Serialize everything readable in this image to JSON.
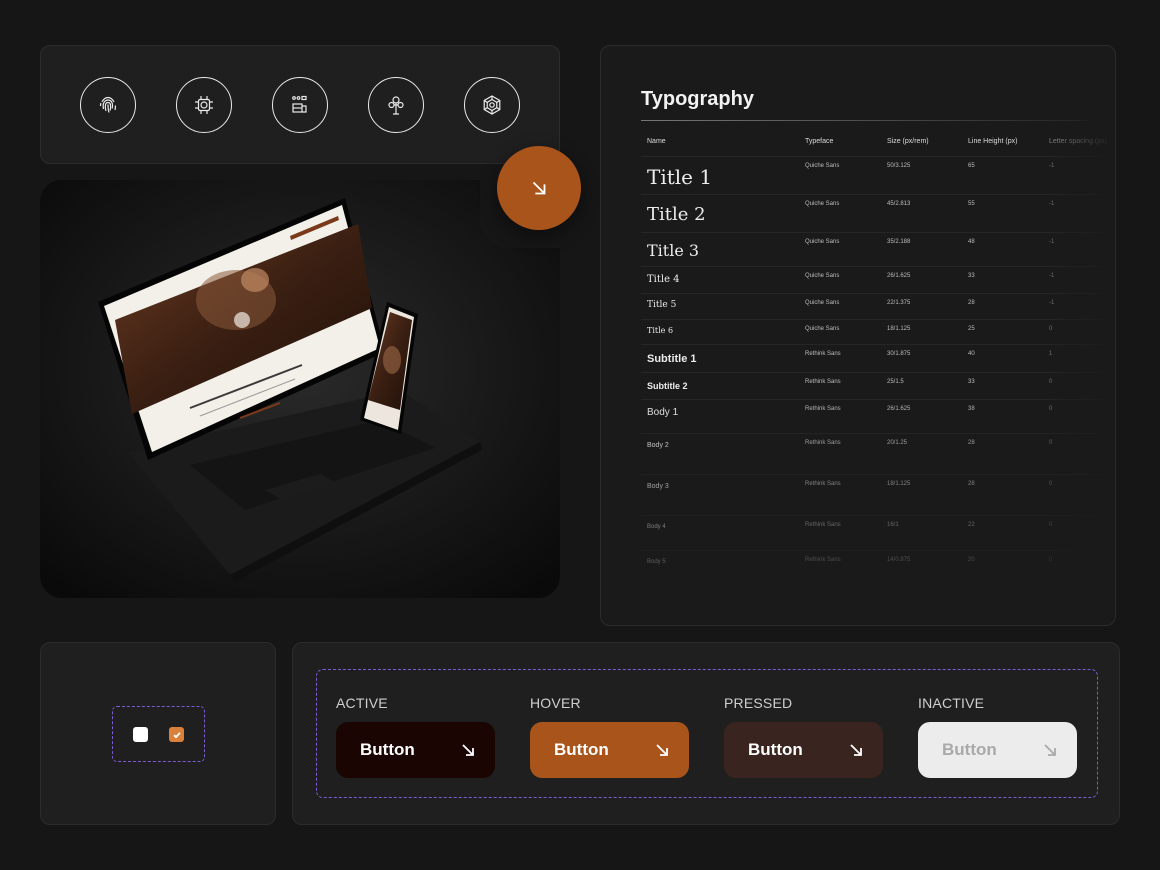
{
  "icons": [
    "fingerprint-icon",
    "chip-icon",
    "workbench-icon",
    "flower-icon",
    "hexagon-gem-icon"
  ],
  "accent_color": "#a8541a",
  "typography": {
    "title": "Typography",
    "headers": {
      "name": "Name",
      "typeface": "Typeface",
      "size": "Size (px/rem)",
      "line_height": "Line Height (px)",
      "letter_spacing": "Letter spacing (px)"
    },
    "rows": [
      {
        "name": "Title 1",
        "typeface": "Quiche Sans",
        "size": "50/3.125",
        "line_height": "65",
        "letter_spacing": "-1"
      },
      {
        "name": "Title 2",
        "typeface": "Quiche Sans",
        "size": "45/2.813",
        "line_height": "55",
        "letter_spacing": "-1"
      },
      {
        "name": "Title 3",
        "typeface": "Quiche Sans",
        "size": "35/2.188",
        "line_height": "48",
        "letter_spacing": "-1"
      },
      {
        "name": "Title 4",
        "typeface": "Quiche Sans",
        "size": "26/1.625",
        "line_height": "33",
        "letter_spacing": "-1"
      },
      {
        "name": "Title 5",
        "typeface": "Quiche Sans",
        "size": "22/1.375",
        "line_height": "28",
        "letter_spacing": "-1"
      },
      {
        "name": "Title 6",
        "typeface": "Quiche Sans",
        "size": "18/1.125",
        "line_height": "25",
        "letter_spacing": "0"
      },
      {
        "name": "Subtitle 1",
        "typeface": "Rethink Sans",
        "size": "30/1.875",
        "line_height": "40",
        "letter_spacing": "1"
      },
      {
        "name": "Subtitle 2",
        "typeface": "Rethink Sans",
        "size": "25/1.5",
        "line_height": "33",
        "letter_spacing": "0"
      },
      {
        "name": "Body 1",
        "typeface": "Rethink Sans",
        "size": "26/1.625",
        "line_height": "38",
        "letter_spacing": "0"
      },
      {
        "name": "Body 2",
        "typeface": "Rethink Sans",
        "size": "20/1.25",
        "line_height": "28",
        "letter_spacing": "0"
      },
      {
        "name": "Body 3",
        "typeface": "Rethink Sans",
        "size": "18/1.125",
        "line_height": "28",
        "letter_spacing": "0"
      },
      {
        "name": "Body 4",
        "typeface": "Rethink Sans",
        "size": "16/1",
        "line_height": "22",
        "letter_spacing": "0"
      },
      {
        "name": "Body 5",
        "typeface": "Rethink Sans",
        "size": "14/0.875",
        "line_height": "20",
        "letter_spacing": "0"
      }
    ]
  },
  "checkboxes": [
    {
      "state": "unchecked"
    },
    {
      "state": "checked"
    }
  ],
  "buttons": {
    "states": [
      {
        "label": "ACTIVE",
        "button_text": "Button",
        "bg": "#1a0503"
      },
      {
        "label": "HOVER",
        "button_text": "Button",
        "bg": "#a8541a"
      },
      {
        "label": "PRESSED",
        "button_text": "Button",
        "bg": "#3a2420"
      },
      {
        "label": "INACTIVE",
        "button_text": "Button",
        "bg": "#ececec"
      }
    ]
  }
}
